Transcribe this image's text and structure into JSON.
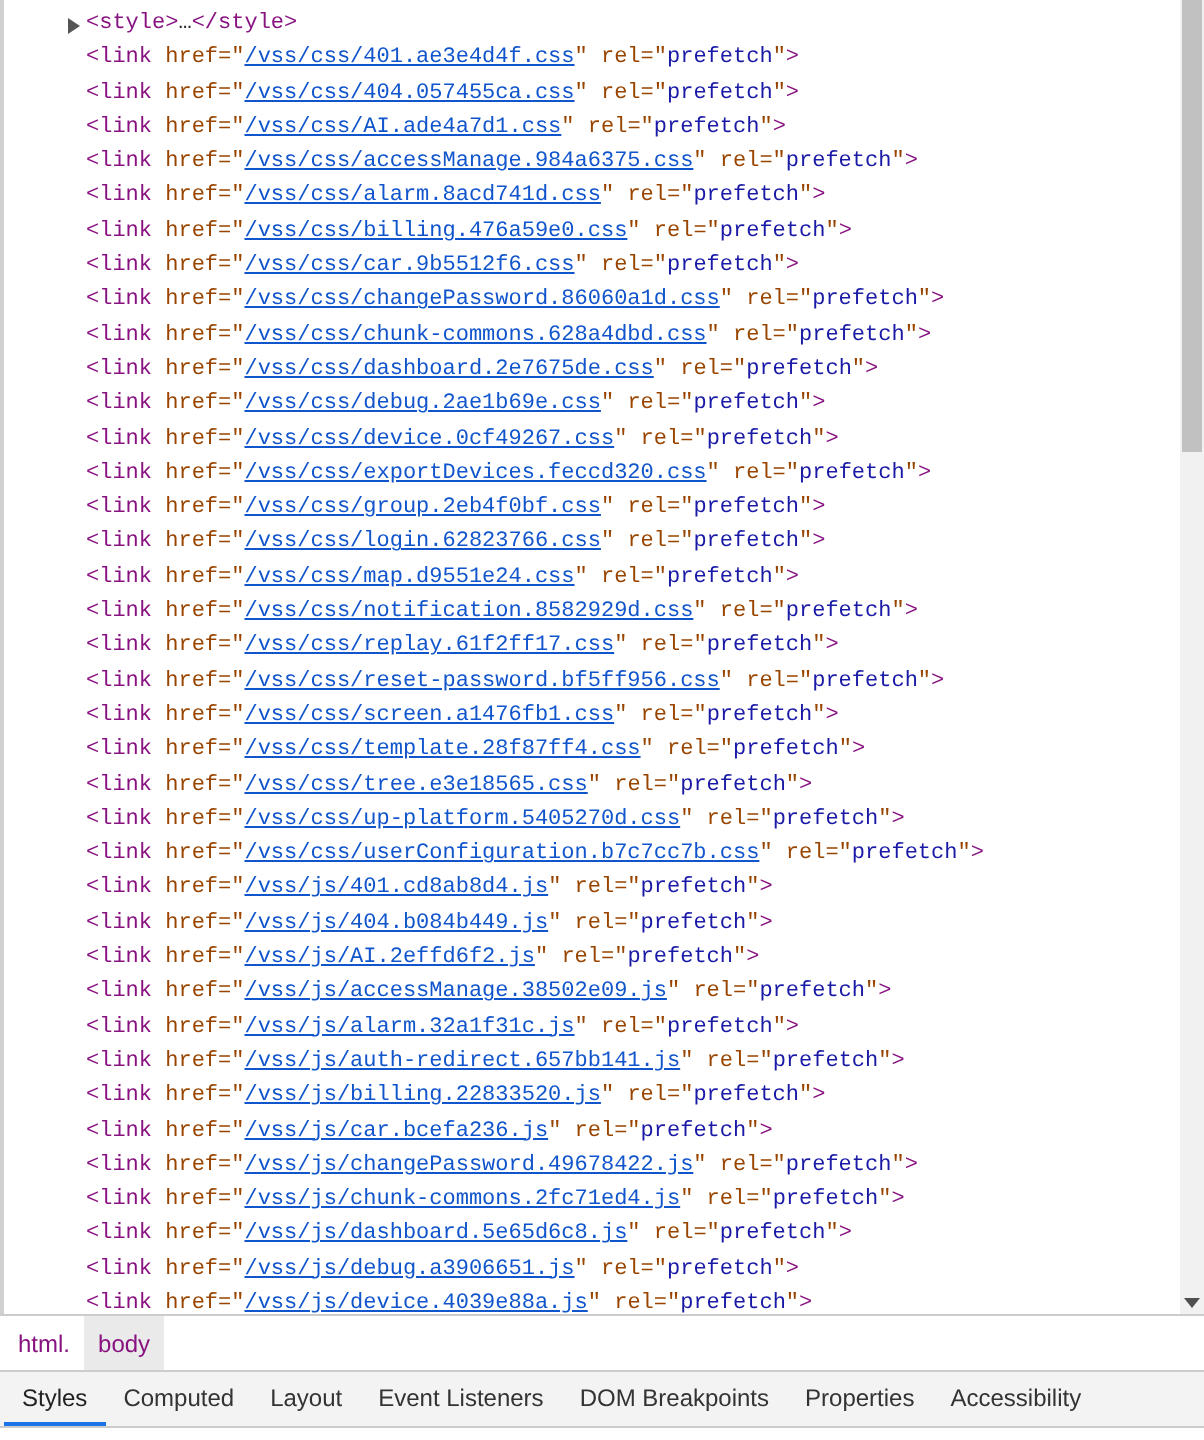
{
  "elements": [
    {
      "kind": "collapsed",
      "expanded": false,
      "markup": "<style>…</style>"
    },
    {
      "kind": "tag",
      "linked": true,
      "markup": "<link href=\"/vss/css/401.ae3e4d4f.css\" rel=\"prefetch\">"
    },
    {
      "kind": "tag",
      "linked": true,
      "markup": "<link href=\"/vss/css/404.057455ca.css\" rel=\"prefetch\">"
    },
    {
      "kind": "tag",
      "linked": true,
      "markup": "<link href=\"/vss/css/AI.ade4a7d1.css\" rel=\"prefetch\">"
    },
    {
      "kind": "tag",
      "linked": true,
      "markup": "<link href=\"/vss/css/accessManage.984a6375.css\" rel=\"prefetch\">"
    },
    {
      "kind": "tag",
      "linked": true,
      "markup": "<link href=\"/vss/css/alarm.8acd741d.css\" rel=\"prefetch\">"
    },
    {
      "kind": "tag",
      "linked": true,
      "markup": "<link href=\"/vss/css/billing.476a59e0.css\" rel=\"prefetch\">"
    },
    {
      "kind": "tag",
      "linked": true,
      "markup": "<link href=\"/vss/css/car.9b5512f6.css\" rel=\"prefetch\">"
    },
    {
      "kind": "tag",
      "linked": true,
      "markup": "<link href=\"/vss/css/changePassword.86060a1d.css\" rel=\"prefetch\">"
    },
    {
      "kind": "tag",
      "linked": true,
      "markup": "<link href=\"/vss/css/chunk-commons.628a4dbd.css\" rel=\"prefetch\">"
    },
    {
      "kind": "tag",
      "linked": true,
      "markup": "<link href=\"/vss/css/dashboard.2e7675de.css\" rel=\"prefetch\">"
    },
    {
      "kind": "tag",
      "linked": true,
      "markup": "<link href=\"/vss/css/debug.2ae1b69e.css\" rel=\"prefetch\">"
    },
    {
      "kind": "tag",
      "linked": true,
      "markup": "<link href=\"/vss/css/device.0cf49267.css\" rel=\"prefetch\">"
    },
    {
      "kind": "tag",
      "linked": true,
      "markup": "<link href=\"/vss/css/exportDevices.feccd320.css\" rel=\"prefetch\">"
    },
    {
      "kind": "tag",
      "linked": true,
      "markup": "<link href=\"/vss/css/group.2eb4f0bf.css\" rel=\"prefetch\">"
    },
    {
      "kind": "tag",
      "linked": true,
      "markup": "<link href=\"/vss/css/login.62823766.css\" rel=\"prefetch\">"
    },
    {
      "kind": "tag",
      "linked": true,
      "markup": "<link href=\"/vss/css/map.d9551e24.css\" rel=\"prefetch\">"
    },
    {
      "kind": "tag",
      "linked": true,
      "markup": "<link href=\"/vss/css/notification.8582929d.css\" rel=\"prefetch\">"
    },
    {
      "kind": "tag",
      "linked": true,
      "markup": "<link href=\"/vss/css/replay.61f2ff17.css\" rel=\"prefetch\">"
    },
    {
      "kind": "tag",
      "linked": true,
      "markup": "<link href=\"/vss/css/reset-password.bf5ff956.css\" rel=\"prefetch\">"
    },
    {
      "kind": "tag",
      "linked": true,
      "markup": "<link href=\"/vss/css/screen.a1476fb1.css\" rel=\"prefetch\">"
    },
    {
      "kind": "tag",
      "linked": true,
      "markup": "<link href=\"/vss/css/template.28f87ff4.css\" rel=\"prefetch\">"
    },
    {
      "kind": "tag",
      "linked": true,
      "markup": "<link href=\"/vss/css/tree.e3e18565.css\" rel=\"prefetch\">"
    },
    {
      "kind": "tag",
      "linked": true,
      "markup": "<link href=\"/vss/css/up-platform.5405270d.css\" rel=\"prefetch\">"
    },
    {
      "kind": "tag",
      "linked": true,
      "markup": "<link href=\"/vss/css/userConfiguration.b7c7cc7b.css\" rel=\"prefetch\">"
    },
    {
      "kind": "tag",
      "linked": true,
      "markup": "<link href=\"/vss/js/401.cd8ab8d4.js\" rel=\"prefetch\">"
    },
    {
      "kind": "tag",
      "linked": true,
      "markup": "<link href=\"/vss/js/404.b084b449.js\" rel=\"prefetch\">"
    },
    {
      "kind": "tag",
      "linked": true,
      "markup": "<link href=\"/vss/js/AI.2effd6f2.js\" rel=\"prefetch\">"
    },
    {
      "kind": "tag",
      "linked": true,
      "markup": "<link href=\"/vss/js/accessManage.38502e09.js\" rel=\"prefetch\">"
    },
    {
      "kind": "tag",
      "linked": true,
      "markup": "<link href=\"/vss/js/alarm.32a1f31c.js\" rel=\"prefetch\">"
    },
    {
      "kind": "tag",
      "linked": true,
      "markup": "<link href=\"/vss/js/auth-redirect.657bb141.js\" rel=\"prefetch\">"
    },
    {
      "kind": "tag",
      "linked": true,
      "markup": "<link href=\"/vss/js/billing.22833520.js\" rel=\"prefetch\">"
    },
    {
      "kind": "tag",
      "linked": true,
      "markup": "<link href=\"/vss/js/car.bcefa236.js\" rel=\"prefetch\">"
    },
    {
      "kind": "tag",
      "linked": true,
      "markup": "<link href=\"/vss/js/changePassword.49678422.js\" rel=\"prefetch\">"
    },
    {
      "kind": "tag",
      "linked": true,
      "markup": "<link href=\"/vss/js/chunk-commons.2fc71ed4.js\" rel=\"prefetch\">"
    },
    {
      "kind": "tag",
      "linked": true,
      "markup": "<link href=\"/vss/js/dashboard.5e65d6c8.js\" rel=\"prefetch\">"
    },
    {
      "kind": "tag",
      "linked": true,
      "markup": "<link href=\"/vss/js/debug.a3906651.js\" rel=\"prefetch\">"
    },
    {
      "kind": "tag",
      "linked": true,
      "markup": "<link href=\"/vss/js/device.4039e88a.js\" rel=\"prefetch\">"
    }
  ],
  "breadcrumbs": [
    {
      "label": "html.",
      "selected": false
    },
    {
      "label": "body",
      "selected": true
    }
  ],
  "tabs": [
    {
      "label": "Styles",
      "selected": true
    },
    {
      "label": "Computed",
      "selected": false
    },
    {
      "label": "Layout",
      "selected": false
    },
    {
      "label": "Event Listeners",
      "selected": false
    },
    {
      "label": "DOM Breakpoints",
      "selected": false
    },
    {
      "label": "Properties",
      "selected": false
    },
    {
      "label": "Accessibility",
      "selected": false
    }
  ]
}
